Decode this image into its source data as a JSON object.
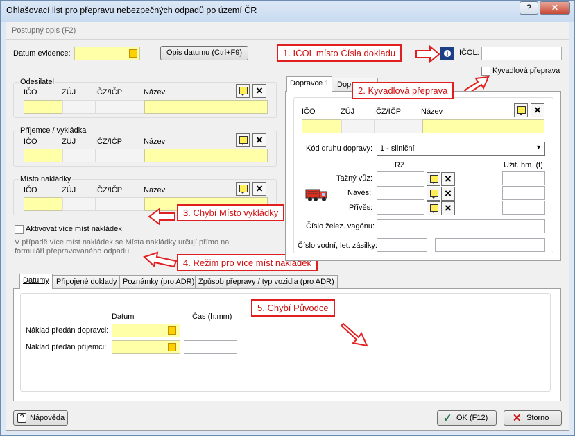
{
  "window": {
    "title": "Ohlašovací list pro přepravu nebezpečných odpadů po území ČR",
    "help": "?",
    "close": "✕"
  },
  "header": {
    "postupny_opis": "Postupný opis (F2)"
  },
  "top": {
    "datum_evidence_label": "Datum evidence:",
    "opis_datumu_button": "Opis datumu  (Ctrl+F9)",
    "icol_label": "IČOL:",
    "info_icon": "info-icon"
  },
  "annotations": {
    "a1": "1. IČOL místo Čísla dokladu",
    "a2": "2. Kyvadlová přeprava",
    "a3": "3. Chybí Místo vykládky",
    "a4": "4. Režim pro více míst nakládek",
    "a5": "5. Chybí Původce"
  },
  "columns": {
    "ico": "IČO",
    "zuj": "ZÚJ",
    "iczicp": "IČZ/IČP",
    "nazev": "Název"
  },
  "odesilatel": {
    "title": "Odesilatel"
  },
  "prijemce": {
    "title": "Příjemce / vykládka"
  },
  "misto_nakladky": {
    "title": "Místo nakládky"
  },
  "vice_mist": {
    "checkbox_label": "Aktivovat více míst nakládek",
    "hint": "V případě více míst nakládek se Místa nakládky určují přímo na formuláři přepravovaného odpadu."
  },
  "kyvadlova": {
    "label": "Kyvadlová přeprava",
    "checked": false
  },
  "dopravce_tabs": [
    "Dopravce 1",
    "Dop"
  ],
  "dopravce": {
    "kod_label": "Kód druhu dopravy:",
    "kod_value": "1 - silniční",
    "rz_label": "RZ",
    "uzit_label": "Užit. hm. (t)",
    "tazny_label": "Tažný vůz:",
    "naves_label": "Návěs:",
    "prives_label": "Přívěs:",
    "zelez_label": "Číslo želez. vagónu:",
    "vodni_label": "Číslo vodní, let. zásilky:"
  },
  "bottom_tabs": [
    "Datumy",
    "Připojené doklady",
    "Poznámky (pro ADR)",
    "Způsob přepravy / typ vozidla (pro ADR)"
  ],
  "datumy": {
    "datum_header": "Datum",
    "cas_header": "Čas (h:mm)",
    "naklad_dopravci": "Náklad předán dopravci:",
    "naklad_prijemci": "Náklad předán příjemci:"
  },
  "footer": {
    "napoveda": "Nápověda",
    "ok": "OK (F12)",
    "storno": "Storno"
  },
  "colors": {
    "annotation": "#e02020",
    "required_field": "#ffffa8"
  }
}
